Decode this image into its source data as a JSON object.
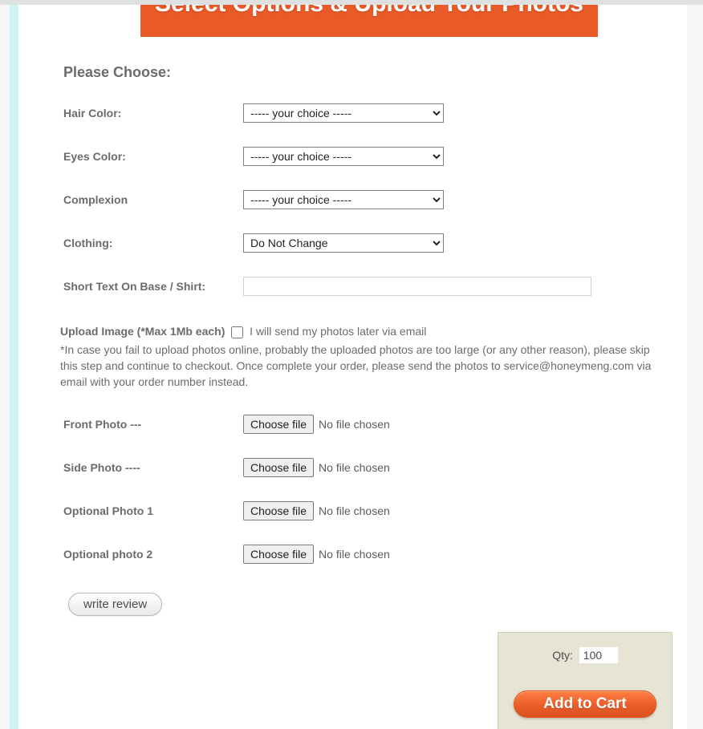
{
  "banner": {
    "title": "Select Options & Upload Your Photos"
  },
  "choose_heading": "Please Choose:",
  "options": {
    "hair_color": {
      "label": "Hair Color:",
      "selected": "----- your choice -----"
    },
    "eyes_color": {
      "label": "Eyes Color:",
      "selected": "----- your choice -----"
    },
    "complexion": {
      "label": "Complexion",
      "selected": "----- your choice -----"
    },
    "clothing": {
      "label": "Clothing:",
      "selected": "Do Not Change"
    },
    "short_text": {
      "label": "Short Text On Base / Shirt:",
      "value": ""
    }
  },
  "upload": {
    "label": "Upload Image (*Max 1Mb each)",
    "checkbox_label": "I will send my photos later via email",
    "checkbox_checked": false,
    "note": "*In case you fail to upload photos online, probably the uploaded photos are too large (or any other reason), please skip this step and continue to checkout. Once complete your order, please send the photos to service@honeymeng.com via email with your order number instead."
  },
  "photos": {
    "choose_file_label": "Choose file",
    "no_file_text": "No file chosen",
    "items": [
      {
        "label": "Front Photo ---"
      },
      {
        "label": "Side Photo ----"
      },
      {
        "label": "Optional Photo 1"
      },
      {
        "label": "Optional photo 2"
      }
    ]
  },
  "review_button": "write review",
  "cart": {
    "qty_label": "Qty:",
    "qty_value": "100",
    "add_label": "Add to Cart"
  }
}
